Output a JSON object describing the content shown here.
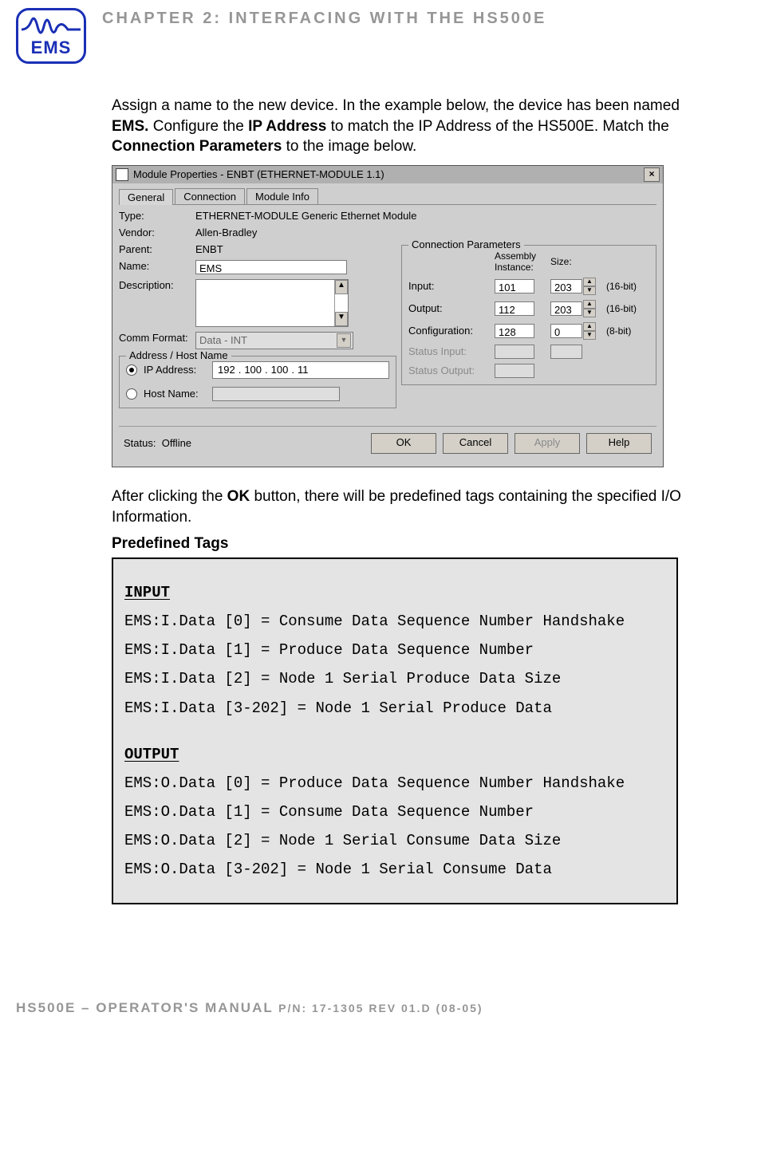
{
  "header": {
    "logo_text": "EMS",
    "chapter_title": "CHAPTER 2: INTERFACING WITH THE HS500E"
  },
  "intro": {
    "line1a": "Assign a name to the new device. In the example below, the device has been named ",
    "bold1": "EMS.",
    "line1b": " Configure the ",
    "bold2": "IP Address",
    "line1c": " to match the IP Address of the HS500E. Match the ",
    "bold3": "Connection Parameters",
    "line1d": " to the image below."
  },
  "dialog": {
    "title": "Module Properties  - ENBT (ETHERNET-MODULE 1.1)",
    "close": "×",
    "tabs": {
      "general": "General",
      "connection": "Connection",
      "module_info": "Module Info"
    },
    "labels": {
      "type": "Type:",
      "vendor": "Vendor:",
      "parent": "Parent:",
      "name": "Name:",
      "description": "Description:",
      "comm_format": "Comm Format:",
      "address_host": "Address / Host Name",
      "ip_address": "IP Address:",
      "host_name": "Host Name:",
      "conn_params": "Connection Parameters",
      "assembly_instance": "Assembly\nInstance:",
      "size": "Size:",
      "input": "Input:",
      "output": "Output:",
      "configuration": "Configuration:",
      "status_input": "Status Input:",
      "status_output": "Status Output:",
      "status": "Status:"
    },
    "values": {
      "type": "ETHERNET-MODULE Generic Ethernet Module",
      "vendor": "Allen-Bradley",
      "parent": "ENBT",
      "name": "EMS",
      "comm_format": "Data - INT",
      "ip": {
        "a": "192",
        "b": "100",
        "c": "100",
        "d": "11"
      },
      "input_ai": "101",
      "input_size": "203",
      "input_unit": "(16-bit)",
      "output_ai": "112",
      "output_size": "203",
      "output_unit": "(16-bit)",
      "config_ai": "128",
      "config_size": "0",
      "config_unit": "(8-bit)",
      "status_value": "Offline"
    },
    "buttons": {
      "ok": "OK",
      "cancel": "Cancel",
      "apply": "Apply",
      "help": "Help"
    }
  },
  "after": {
    "line_a": "After clicking the ",
    "bold": "OK",
    "line_b": " button, there will be predefined tags containing the specified I/O Information."
  },
  "tags_heading": "Predefined Tags",
  "tags": {
    "input_head": "INPUT",
    "in0": "EMS:I.Data [0] = Consume Data Sequence Number Handshake",
    "in1": "EMS:I.Data [1] = Produce Data Sequence Number",
    "in2": "EMS:I.Data [2] = Node 1 Serial Produce Data Size",
    "in3": "EMS:I.Data [3-202] = Node 1 Serial Produce Data",
    "output_head": "OUTPUT",
    "out0": "EMS:O.Data [0] = Produce Data Sequence Number Handshake",
    "out1": "EMS:O.Data [1] = Consume Data Sequence Number",
    "out2": "EMS:O.Data [2] = Node 1 Serial Consume Data Size",
    "out3": "EMS:O.Data [3-202] = Node 1 Serial Consume Data"
  },
  "footer": {
    "main": "HS500E – OPERATOR'S MANUAL ",
    "small": "P/N: 17-1305 REV 01.D (08-05)"
  }
}
